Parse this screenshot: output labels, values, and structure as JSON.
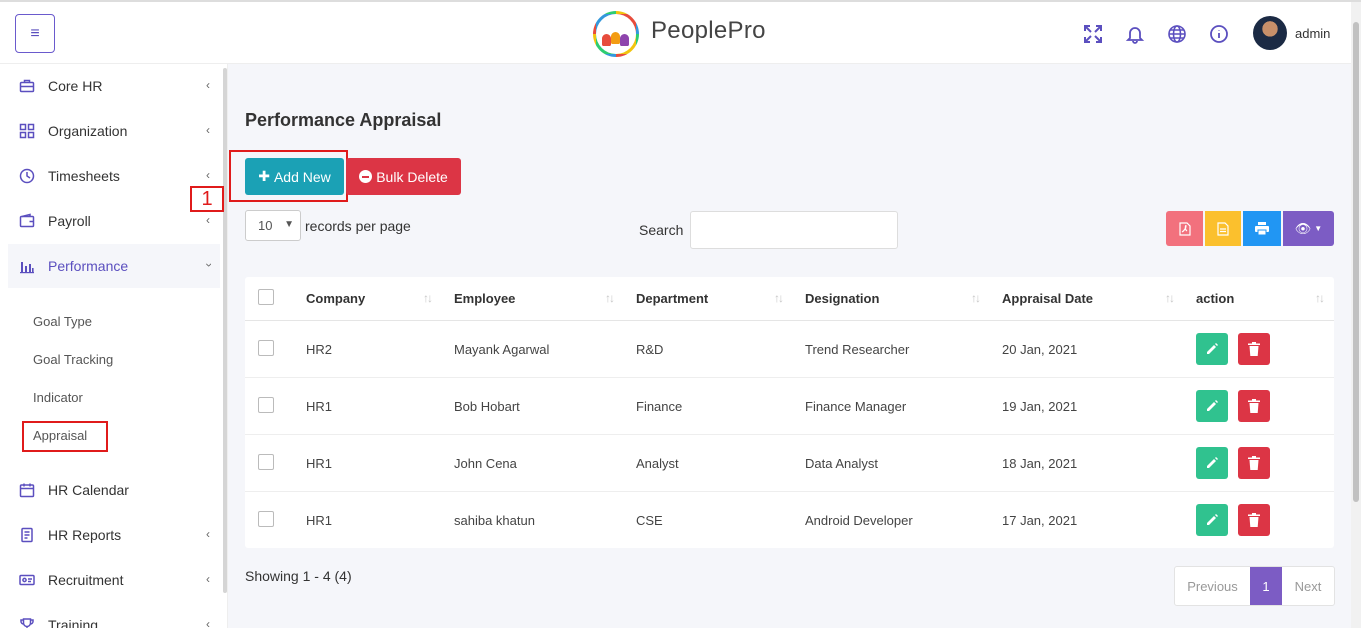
{
  "header": {
    "menu_icon": "hamburger-icon",
    "brand": "PeoplePro",
    "icons": [
      "fullscreen-icon",
      "bell-icon",
      "globe-icon",
      "info-icon"
    ],
    "user": "admin"
  },
  "sidebar": {
    "items": [
      {
        "label": "Core HR",
        "icon": "briefcase-icon"
      },
      {
        "label": "Organization",
        "icon": "grid-icon"
      },
      {
        "label": "Timesheets",
        "icon": "clock-icon"
      },
      {
        "label": "Payroll",
        "icon": "wallet-icon"
      },
      {
        "label": "Performance",
        "icon": "bar-chart-icon"
      },
      {
        "label": "HR Calendar",
        "icon": "calendar-icon"
      },
      {
        "label": "HR Reports",
        "icon": "report-icon"
      },
      {
        "label": "Recruitment",
        "icon": "id-card-icon"
      },
      {
        "label": "Training",
        "icon": "trophy-icon"
      }
    ],
    "sub_items": [
      "Goal Type",
      "Goal Tracking",
      "Indicator",
      "Appraisal"
    ]
  },
  "annotation": {
    "marker": "1"
  },
  "main": {
    "title": "Performance Appraisal",
    "add_new": "Add New",
    "bulk_delete": "Bulk Delete",
    "page_length": "10",
    "records_per_page": "records per page",
    "search_label": "Search",
    "search_value": "",
    "export_colors": {
      "pdf": "#f2717d",
      "csv": "#fbc02d",
      "print": "#2196f3",
      "columns": "#7c5cc4"
    }
  },
  "table": {
    "headers": [
      "Company",
      "Employee",
      "Department",
      "Designation",
      "Appraisal Date",
      "action"
    ],
    "rows": [
      [
        "HR2",
        "Mayank Agarwal",
        "R&D",
        "Trend Researcher",
        "20 Jan, 2021"
      ],
      [
        "HR1",
        "Bob Hobart",
        "Finance",
        "Finance Manager",
        "19 Jan, 2021"
      ],
      [
        "HR1",
        "John Cena",
        "Analyst",
        "Data Analyst",
        "18 Jan, 2021"
      ],
      [
        "HR1",
        "sahiba khatun",
        "CSE",
        "Android Developer",
        "17 Jan, 2021"
      ]
    ]
  },
  "footer": {
    "showing": "Showing 1 - 4 (4)",
    "previous": "Previous",
    "current_page": "1",
    "next": "Next"
  }
}
